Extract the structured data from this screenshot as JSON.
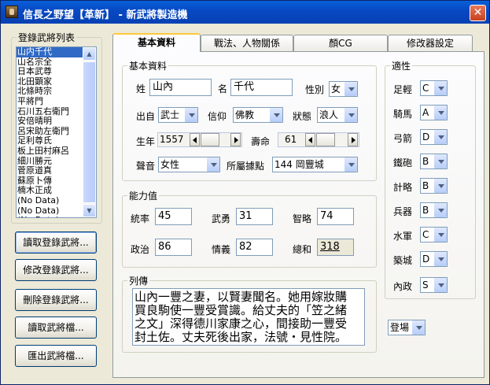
{
  "window": {
    "title": "信長之野望【革新】 - 新武將製造機",
    "close_glyph": "✕"
  },
  "left_panel": {
    "legend": "登錄武將列表",
    "list_items": [
      "山内千代",
      "山名宗全",
      "日本武尊",
      "北田顕家",
      "北條時宗",
      "平將門",
      "石川五右衛門",
      "安倍晴明",
      "呂宋助左衛門",
      "足利尊氏",
      "板上田村麻呂",
      "細川勝元",
      "菅原道真",
      "蘇原卜傳",
      "楠木正成",
      "(No Data)",
      "(No Data)",
      "(No Data)"
    ],
    "selected_index": 0,
    "buttons": [
      "讀取登錄武將...",
      "修改登錄武將...",
      "刪除登錄武將...",
      "讀取武將檔...",
      "匯出武將檔..."
    ]
  },
  "tabs": [
    "基本資料",
    "戰法、人物關係",
    "顏CG",
    "修改器設定"
  ],
  "active_tab": 0,
  "basic": {
    "legend": "基本資料",
    "surname_label": "姓",
    "surname": "山內",
    "given_label": "名",
    "given": "千代",
    "gender_label": "性別",
    "gender": "女",
    "origin_label": "出自",
    "origin": "武士",
    "belief_label": "信仰",
    "belief": "佛教",
    "status_label": "狀態",
    "status": "浪人",
    "birth_label": "生年",
    "birth": "1557",
    "life_label": "壽命",
    "life": "61",
    "voice_label": "聲音",
    "voice": "女性",
    "base_label": "所屬據點",
    "base": "144 岡豐城"
  },
  "abilities": {
    "legend": "能力值",
    "leadership_label": "統率",
    "leadership": "45",
    "valor_label": "武勇",
    "valor": "31",
    "intellect_label": "智略",
    "intellect": "74",
    "politics_label": "政治",
    "politics": "86",
    "charisma_label": "情義",
    "charisma": "82",
    "total_label": "總和",
    "total": "318"
  },
  "biography": {
    "legend": "列傳",
    "lines": [
      "山內一豐之妻，以賢妻聞名。她用嫁妝購",
      "買良駒使一豐受賞識。給丈夫的「笠之緒",
      "之文」深得德川家康之心，間接助一豐受",
      "封土佐。丈夫死後出家，法號・見性院。"
    ]
  },
  "aptitude": {
    "legend": "適性",
    "rows": [
      {
        "label": "足輕",
        "value": "C"
      },
      {
        "label": "騎馬",
        "value": "A"
      },
      {
        "label": "弓箭",
        "value": "D"
      },
      {
        "label": "鐵砲",
        "value": "B"
      },
      {
        "label": "計略",
        "value": "B"
      },
      {
        "label": "兵器",
        "value": "B"
      },
      {
        "label": "水軍",
        "value": "C"
      },
      {
        "label": "築城",
        "value": "D"
      },
      {
        "label": "內政",
        "value": "S"
      }
    ]
  },
  "appearance": {
    "value": "登場"
  },
  "icons": {
    "close": "close-icon",
    "combo_arrow": "chevron-down-icon",
    "scroll_up": "scroll-up-icon",
    "scroll_down": "scroll-down-icon"
  }
}
